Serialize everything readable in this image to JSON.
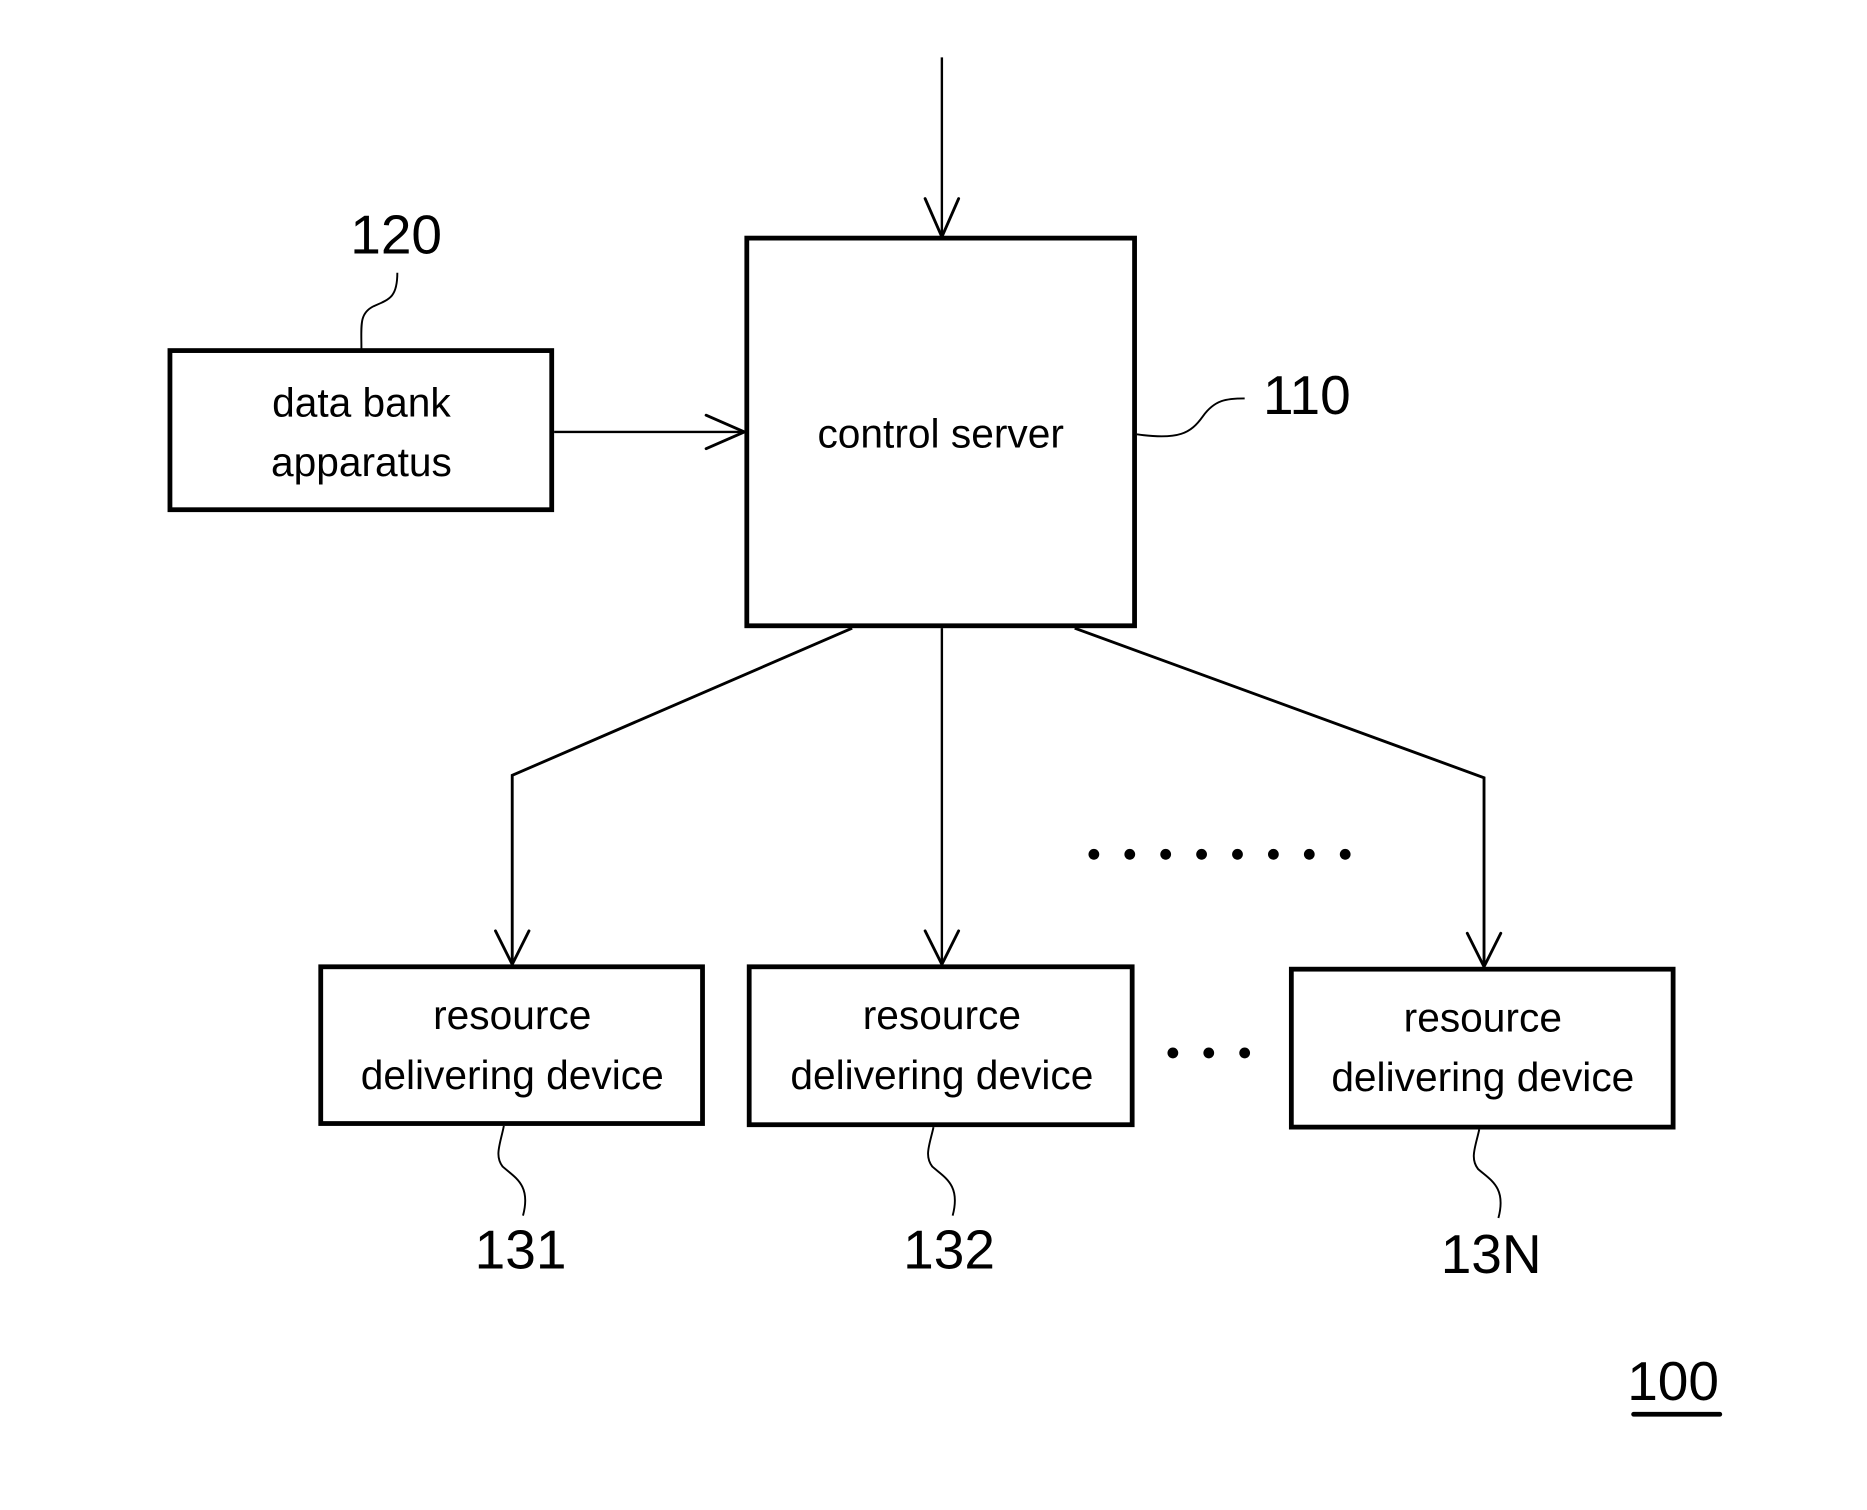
{
  "diagram": {
    "figure_ref": "100",
    "nodes": {
      "control_server": {
        "ref": "110",
        "lines": [
          "control server"
        ]
      },
      "data_bank": {
        "ref": "120",
        "lines": [
          "data bank",
          "apparatus"
        ]
      },
      "device_1": {
        "ref": "131",
        "lines": [
          "resource",
          "delivering device"
        ]
      },
      "device_2": {
        "ref": "132",
        "lines": [
          "resource",
          "delivering device"
        ]
      },
      "device_n": {
        "ref": "13N",
        "lines": [
          "resource",
          "delivering device"
        ]
      }
    },
    "edges": [
      {
        "from": "external-input",
        "to": "control_server"
      },
      {
        "from": "data_bank",
        "to": "control_server"
      },
      {
        "from": "control_server",
        "to": "device_1"
      },
      {
        "from": "control_server",
        "to": "device_2"
      },
      {
        "from": "control_server",
        "to": "device_n"
      }
    ],
    "ellipsis": {
      "upper_dots": 8,
      "lower_dots": 3
    }
  }
}
